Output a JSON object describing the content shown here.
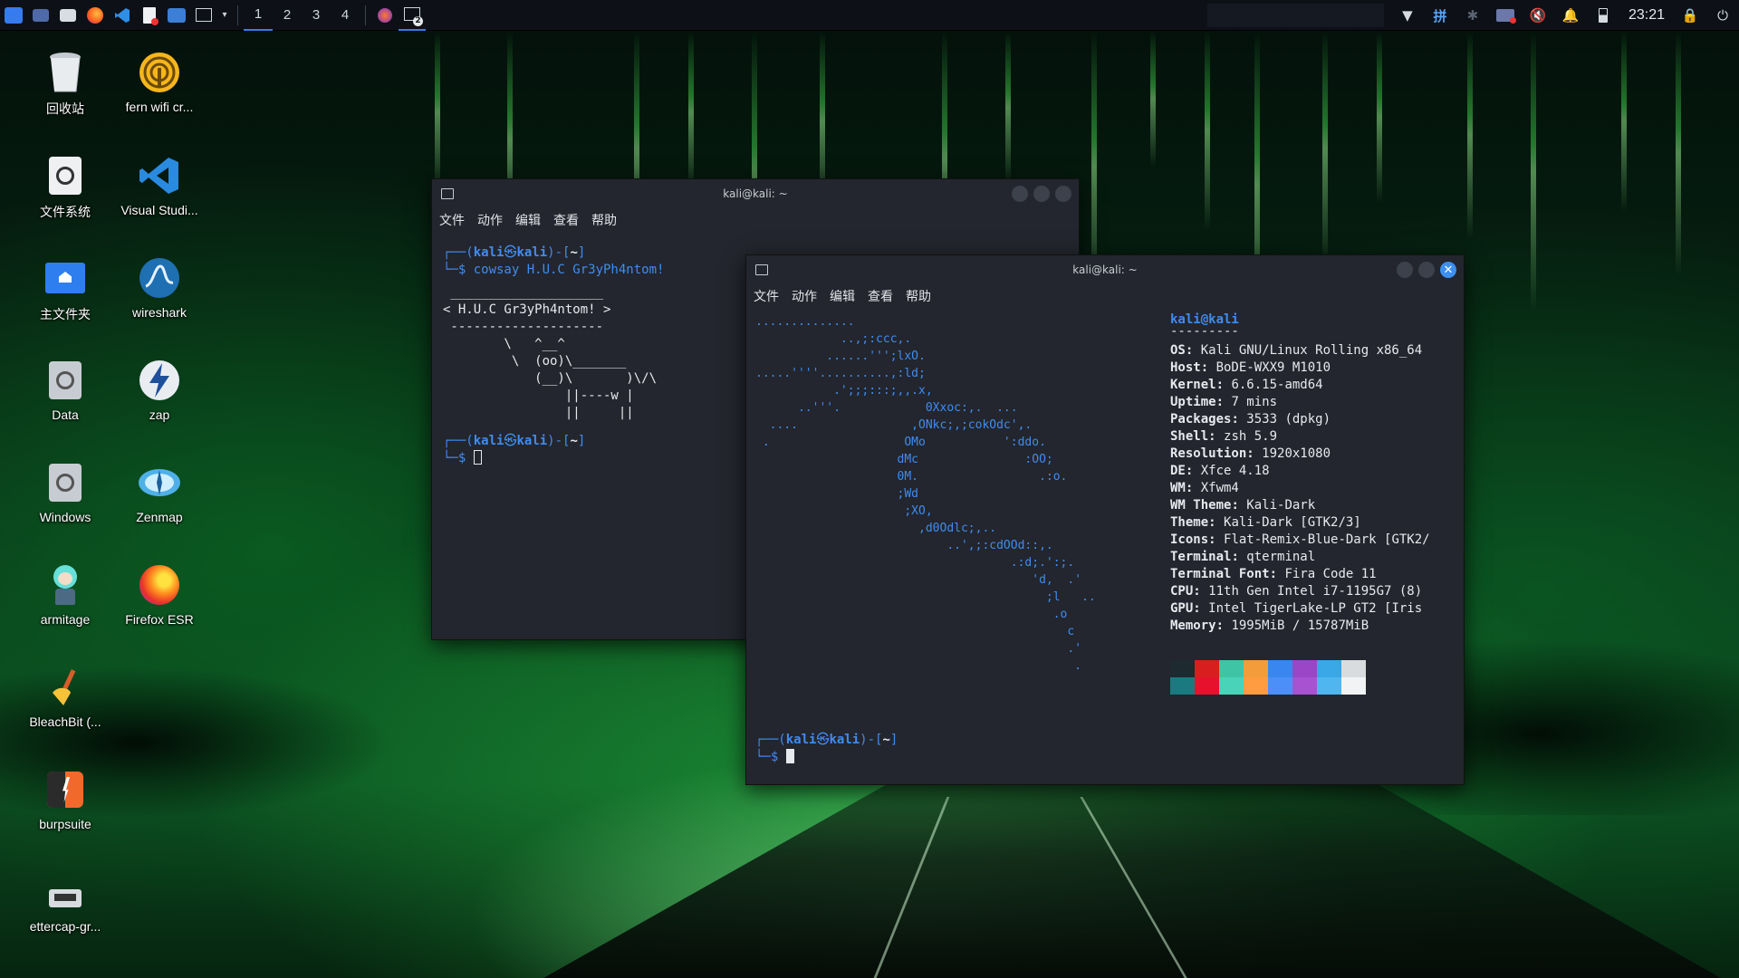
{
  "panel": {
    "workspaces": [
      "1",
      "2",
      "3",
      "4"
    ],
    "active_workspace": "1",
    "clock": "23:21",
    "app_badge": "2",
    "tray_input": "拼"
  },
  "desktop": {
    "icons": [
      {
        "label": "回收站",
        "icon": "trash-icon"
      },
      {
        "label": "fern wifi cr...",
        "icon": "fern-wifi-icon"
      },
      {
        "label": "文件系统",
        "icon": "drive-icon"
      },
      {
        "label": "Visual Studi...",
        "icon": "vscode-icon"
      },
      {
        "label": "主文件夹",
        "icon": "home-folder-icon"
      },
      {
        "label": "wireshark",
        "icon": "wireshark-icon"
      },
      {
        "label": "Data",
        "icon": "drive-icon"
      },
      {
        "label": "zap",
        "icon": "zap-icon"
      },
      {
        "label": "Windows",
        "icon": "drive-icon"
      },
      {
        "label": "Zenmap",
        "icon": "zenmap-icon"
      },
      {
        "label": "armitage",
        "icon": "armitage-icon"
      },
      {
        "label": "Firefox ESR",
        "icon": "firefox-icon"
      },
      {
        "label": "BleachBit (...",
        "icon": "bleachbit-icon"
      },
      {
        "label": "burpsuite",
        "icon": "burpsuite-icon"
      },
      {
        "label": "ettercap-gr...",
        "icon": "ettercap-icon"
      }
    ]
  },
  "terminal1": {
    "title": "kali@kali: ~",
    "menu": [
      "文件",
      "动作",
      "编辑",
      "查看",
      "帮助"
    ],
    "prompt_user": "kali",
    "prompt_at": "㉿",
    "prompt_host": "kali",
    "prompt_dir": "~",
    "command": "cowsay H.U.C Gr3yPh4ntom!",
    "cowsay_top": " ____________________",
    "cowsay_msg": "< H.U.C Gr3yPh4ntom! >",
    "cowsay_bottom": " --------------------",
    "cow_l1": "        \\   ^__^",
    "cow_l2": "         \\  (oo)\\_______",
    "cow_l3": "            (__)\\       )\\/\\",
    "cow_l4": "                ||----w |",
    "cow_l5": "                ||     ||"
  },
  "terminal2": {
    "title": "kali@kali: ~",
    "menu": [
      "文件",
      "动作",
      "编辑",
      "查看",
      "帮助"
    ],
    "user_host": "kali@kali",
    "underline": "---------",
    "logo": [
      "..............",
      "            ..,;:ccc,.",
      "          ......''';lxO.",
      ".....''''..........,:ld;",
      "           .';;;:::;,,.x,",
      "      ..'''.            0Xxoc:,.  ...",
      "  ....                ,ONkc;,;cokOdc',.",
      " .                   OMo           ':ddo.",
      "                    dMc               :OO;",
      "                    0M.                 .:o.",
      "                    ;Wd",
      "                     ;XO,",
      "                       ,d0Odlc;,..",
      "                           ..',;:cdOOd::,.",
      "                                    .:d;.':;.",
      "                                       'd,  .'",
      "                                         ;l   ..",
      "                                          .o",
      "                                            c",
      "                                            .'",
      "                                             ."
    ],
    "info": [
      {
        "key": "OS",
        "value": "Kali GNU/Linux Rolling x86_64"
      },
      {
        "key": "Host",
        "value": "BoDE-WXX9 M1010"
      },
      {
        "key": "Kernel",
        "value": "6.6.15-amd64"
      },
      {
        "key": "Uptime",
        "value": "7 mins"
      },
      {
        "key": "Packages",
        "value": "3533 (dpkg)"
      },
      {
        "key": "Shell",
        "value": "zsh 5.9"
      },
      {
        "key": "Resolution",
        "value": "1920x1080"
      },
      {
        "key": "DE",
        "value": "Xfce 4.18"
      },
      {
        "key": "WM",
        "value": "Xfwm4"
      },
      {
        "key": "WM Theme",
        "value": "Kali-Dark"
      },
      {
        "key": "Theme",
        "value": "Kali-Dark [GTK2/3]"
      },
      {
        "key": "Icons",
        "value": "Flat-Remix-Blue-Dark [GTK2/"
      },
      {
        "key": "Terminal",
        "value": "qterminal"
      },
      {
        "key": "Terminal Font",
        "value": "Fira Code 11"
      },
      {
        "key": "CPU",
        "value": "11th Gen Intel i7-1195G7 (8)"
      },
      {
        "key": "GPU",
        "value": "Intel TigerLake-LP GT2 [Iris"
      },
      {
        "key": "Memory",
        "value": "1995MiB / 15787MiB"
      }
    ],
    "palette_top": [
      "#1d2a30",
      "#d81e1e",
      "#3fc4a6",
      "#f39c3c",
      "#3a86f0",
      "#9a46c6",
      "#3aa7e6",
      "#d9dcdf"
    ],
    "palette_bottom": [
      "#1a7a80",
      "#e8112d",
      "#49d3b8",
      "#ff9b40",
      "#4d8ff8",
      "#a852d2",
      "#4fb6f0",
      "#f2f3f4"
    ],
    "prompt_user": "kali",
    "prompt_at": "㉿",
    "prompt_host": "kali",
    "prompt_dir": "~"
  }
}
